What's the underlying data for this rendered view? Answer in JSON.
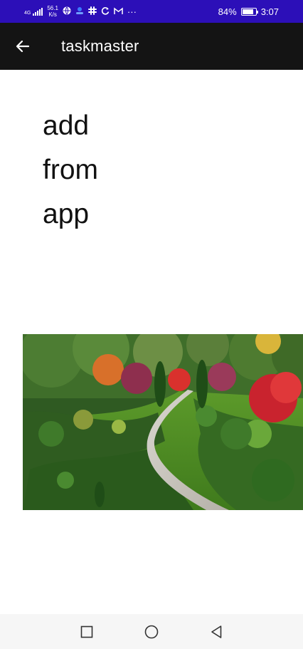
{
  "status_bar": {
    "network_type": "4G",
    "speed_value": "56.1",
    "speed_unit": "K/s",
    "app_icons": [
      "globe-icon",
      "profile-icon",
      "slack-icon",
      "sync-icon",
      "gmail-icon"
    ],
    "more": "···",
    "battery_percent": "84%",
    "battery_level": 0.84,
    "time": "3:07"
  },
  "app_bar": {
    "title": "taskmaster"
  },
  "content": {
    "lines": [
      "add",
      "from",
      "app"
    ]
  },
  "image": {
    "subject": "garden-photo"
  },
  "nav": {
    "buttons": [
      "recent-apps",
      "home",
      "back"
    ]
  },
  "colors": {
    "status_bar": "#2c0fb8",
    "app_bar": "#141414",
    "text": "#111111",
    "nav_bar": "#f6f6f6"
  }
}
